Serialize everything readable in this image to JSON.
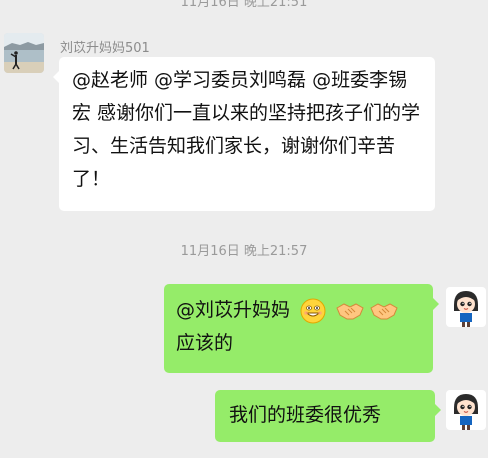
{
  "timestamps": [
    "11月16日 晚上21:51",
    "11月16日 晚上21:57"
  ],
  "contact": {
    "name": "刘苡升妈妈501",
    "avatar_icon": "lake-photo-avatar"
  },
  "messages": [
    {
      "direction": "in",
      "text": "@赵老师 @学习委员刘鸣磊 @班委李锡宏  感谢你们一直以来的坚持把孩子们的学习、生活告知我们家长，谢谢你们辛苦了！"
    },
    {
      "direction": "out",
      "text_line1": "@刘苡升妈妈",
      "text_line2": "应该的",
      "emoji_icons": [
        "grin-emoji-icon",
        "handshake-emoji-icon",
        "handshake-emoji-icon"
      ]
    },
    {
      "direction": "out",
      "text": "我们的班委很优秀"
    }
  ],
  "self": {
    "avatar_icon": "cartoon-girl-avatar"
  },
  "colors": {
    "background": "#ededed",
    "bubble_in": "#ffffff",
    "bubble_out": "#95ec69"
  }
}
